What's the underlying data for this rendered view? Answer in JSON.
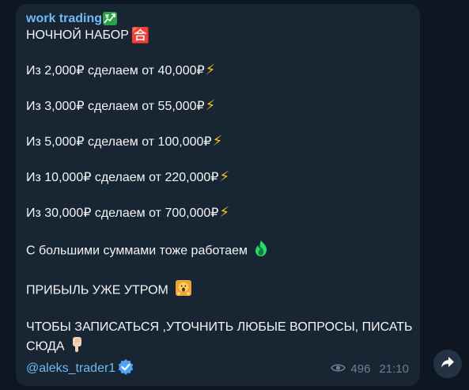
{
  "message": {
    "channel_name": "work trading",
    "channel_emoji": "chart-increasing-with-yen-icon",
    "heading": "НОЧНОЙ НАБОР",
    "heading_emoji": "🈴",
    "offers": [
      {
        "text": "Из 2,000₽ сделаем от 40,000₽",
        "emoji": "⚡"
      },
      {
        "text": "Из 3,000₽ сделаем от 55,000₽",
        "emoji": "⚡"
      },
      {
        "text": "Из 5,000₽ сделаем от 100,000₽",
        "emoji": "⚡"
      },
      {
        "text": "Из 10,000₽ сделаем от 220,000₽",
        "emoji": "⚡"
      },
      {
        "text": "Из 30,000₽ сделаем от 700,000₽",
        "emoji": "⚡"
      }
    ],
    "big_sums": "С большими суммами тоже работаем",
    "profit": "ПРИБЫЛЬ УЖЕ УТРОМ",
    "cta": "ЧТОБЫ ЗАПИСАТЬСЯ ,УТОЧНИТЬ ЛЮБЫЕ ВОПРОСЫ, ПИСАТЬ СЮДА",
    "mention": "@aleks_trader1",
    "views": "496",
    "time": "21:10"
  },
  "colors": {
    "background": "#0e1621",
    "bubble": "#182533",
    "link": "#71baf2",
    "meta": "#6d7f8f",
    "bolt": "#f4c21b"
  }
}
